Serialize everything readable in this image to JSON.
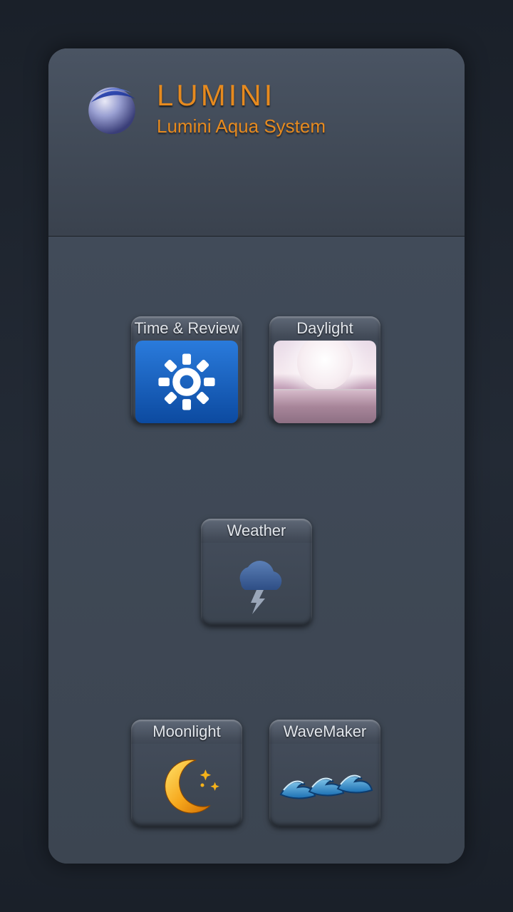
{
  "brand": {
    "title": "LUMINI",
    "subtitle": "Lumini Aqua System"
  },
  "tiles": {
    "time": {
      "label": "Time & Review",
      "icon": "gear-icon"
    },
    "day": {
      "label": "Daylight",
      "icon": "sunrise-icon"
    },
    "weather": {
      "label": "Weather",
      "icon": "storm-icon"
    },
    "moon": {
      "label": "Moonlight",
      "icon": "moon-icon"
    },
    "wave": {
      "label": "WaveMaker",
      "icon": "waves-icon"
    }
  },
  "colors": {
    "accent": "#e68a1f",
    "panel": "#404956"
  }
}
